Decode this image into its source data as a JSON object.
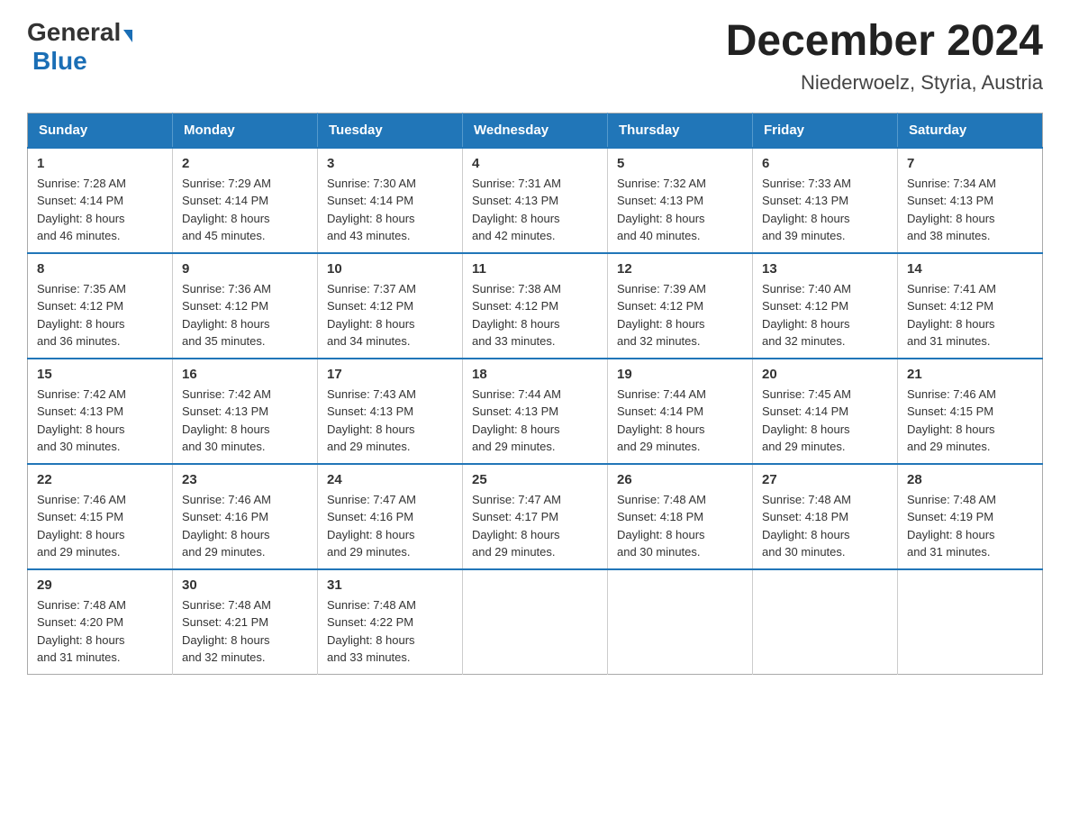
{
  "logo": {
    "general": "General",
    "blue": "Blue",
    "triangle": true
  },
  "title": {
    "month": "December 2024",
    "location": "Niederwoelz, Styria, Austria"
  },
  "headers": [
    "Sunday",
    "Monday",
    "Tuesday",
    "Wednesday",
    "Thursday",
    "Friday",
    "Saturday"
  ],
  "weeks": [
    [
      {
        "day": "1",
        "sunrise": "7:28 AM",
        "sunset": "4:14 PM",
        "daylight": "8 hours and 46 minutes."
      },
      {
        "day": "2",
        "sunrise": "7:29 AM",
        "sunset": "4:14 PM",
        "daylight": "8 hours and 45 minutes."
      },
      {
        "day": "3",
        "sunrise": "7:30 AM",
        "sunset": "4:14 PM",
        "daylight": "8 hours and 43 minutes."
      },
      {
        "day": "4",
        "sunrise": "7:31 AM",
        "sunset": "4:13 PM",
        "daylight": "8 hours and 42 minutes."
      },
      {
        "day": "5",
        "sunrise": "7:32 AM",
        "sunset": "4:13 PM",
        "daylight": "8 hours and 40 minutes."
      },
      {
        "day": "6",
        "sunrise": "7:33 AM",
        "sunset": "4:13 PM",
        "daylight": "8 hours and 39 minutes."
      },
      {
        "day": "7",
        "sunrise": "7:34 AM",
        "sunset": "4:13 PM",
        "daylight": "8 hours and 38 minutes."
      }
    ],
    [
      {
        "day": "8",
        "sunrise": "7:35 AM",
        "sunset": "4:12 PM",
        "daylight": "8 hours and 36 minutes."
      },
      {
        "day": "9",
        "sunrise": "7:36 AM",
        "sunset": "4:12 PM",
        "daylight": "8 hours and 35 minutes."
      },
      {
        "day": "10",
        "sunrise": "7:37 AM",
        "sunset": "4:12 PM",
        "daylight": "8 hours and 34 minutes."
      },
      {
        "day": "11",
        "sunrise": "7:38 AM",
        "sunset": "4:12 PM",
        "daylight": "8 hours and 33 minutes."
      },
      {
        "day": "12",
        "sunrise": "7:39 AM",
        "sunset": "4:12 PM",
        "daylight": "8 hours and 32 minutes."
      },
      {
        "day": "13",
        "sunrise": "7:40 AM",
        "sunset": "4:12 PM",
        "daylight": "8 hours and 32 minutes."
      },
      {
        "day": "14",
        "sunrise": "7:41 AM",
        "sunset": "4:12 PM",
        "daylight": "8 hours and 31 minutes."
      }
    ],
    [
      {
        "day": "15",
        "sunrise": "7:42 AM",
        "sunset": "4:13 PM",
        "daylight": "8 hours and 30 minutes."
      },
      {
        "day": "16",
        "sunrise": "7:42 AM",
        "sunset": "4:13 PM",
        "daylight": "8 hours and 30 minutes."
      },
      {
        "day": "17",
        "sunrise": "7:43 AM",
        "sunset": "4:13 PM",
        "daylight": "8 hours and 29 minutes."
      },
      {
        "day": "18",
        "sunrise": "7:44 AM",
        "sunset": "4:13 PM",
        "daylight": "8 hours and 29 minutes."
      },
      {
        "day": "19",
        "sunrise": "7:44 AM",
        "sunset": "4:14 PM",
        "daylight": "8 hours and 29 minutes."
      },
      {
        "day": "20",
        "sunrise": "7:45 AM",
        "sunset": "4:14 PM",
        "daylight": "8 hours and 29 minutes."
      },
      {
        "day": "21",
        "sunrise": "7:46 AM",
        "sunset": "4:15 PM",
        "daylight": "8 hours and 29 minutes."
      }
    ],
    [
      {
        "day": "22",
        "sunrise": "7:46 AM",
        "sunset": "4:15 PM",
        "daylight": "8 hours and 29 minutes."
      },
      {
        "day": "23",
        "sunrise": "7:46 AM",
        "sunset": "4:16 PM",
        "daylight": "8 hours and 29 minutes."
      },
      {
        "day": "24",
        "sunrise": "7:47 AM",
        "sunset": "4:16 PM",
        "daylight": "8 hours and 29 minutes."
      },
      {
        "day": "25",
        "sunrise": "7:47 AM",
        "sunset": "4:17 PM",
        "daylight": "8 hours and 29 minutes."
      },
      {
        "day": "26",
        "sunrise": "7:48 AM",
        "sunset": "4:18 PM",
        "daylight": "8 hours and 30 minutes."
      },
      {
        "day": "27",
        "sunrise": "7:48 AM",
        "sunset": "4:18 PM",
        "daylight": "8 hours and 30 minutes."
      },
      {
        "day": "28",
        "sunrise": "7:48 AM",
        "sunset": "4:19 PM",
        "daylight": "8 hours and 31 minutes."
      }
    ],
    [
      {
        "day": "29",
        "sunrise": "7:48 AM",
        "sunset": "4:20 PM",
        "daylight": "8 hours and 31 minutes."
      },
      {
        "day": "30",
        "sunrise": "7:48 AM",
        "sunset": "4:21 PM",
        "daylight": "8 hours and 32 minutes."
      },
      {
        "day": "31",
        "sunrise": "7:48 AM",
        "sunset": "4:22 PM",
        "daylight": "8 hours and 33 minutes."
      },
      null,
      null,
      null,
      null
    ]
  ],
  "labels": {
    "sunrise": "Sunrise: ",
    "sunset": "Sunset: ",
    "daylight": "Daylight: "
  }
}
